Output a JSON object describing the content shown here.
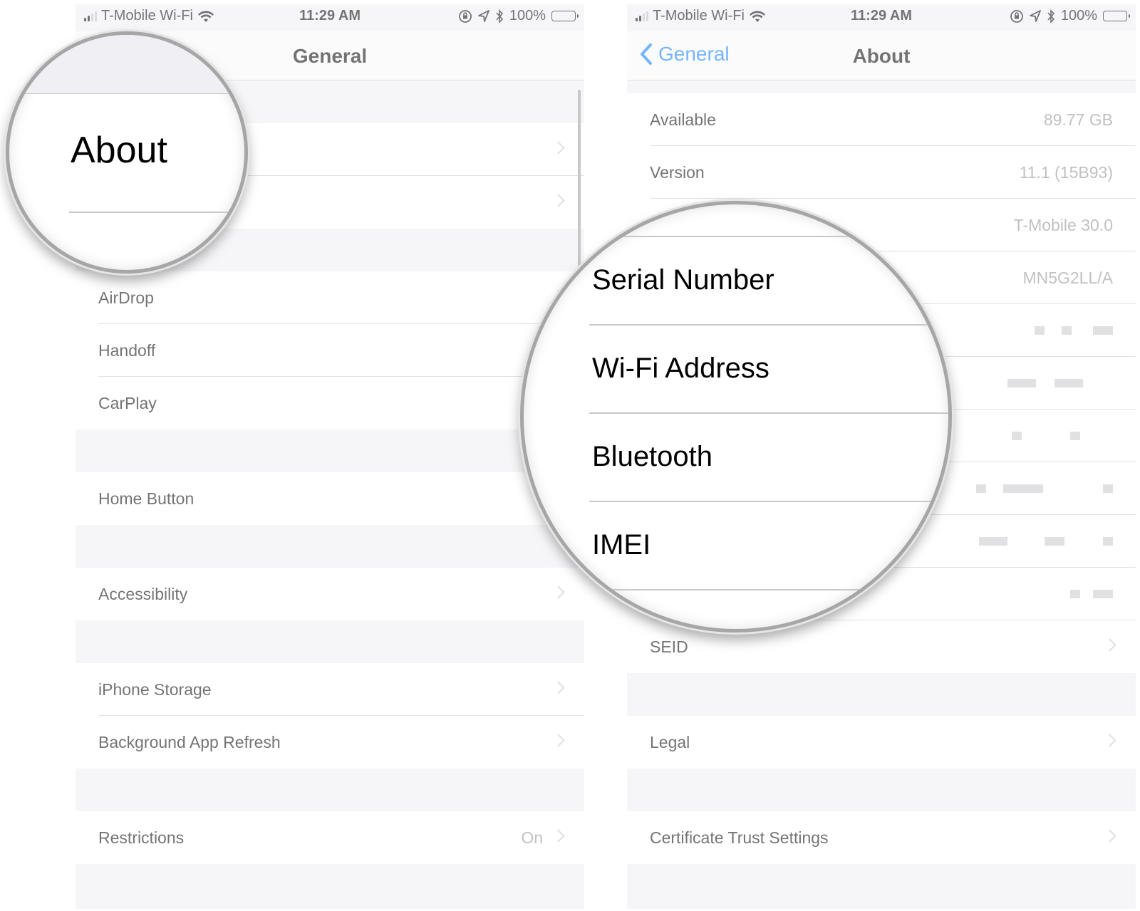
{
  "status": {
    "carrier": "T-Mobile Wi-Fi",
    "time": "11:29 AM",
    "battery": "100%",
    "battery_level": 1.0
  },
  "left": {
    "nav_title": "General",
    "zoom_label": "About",
    "groups": [
      [
        {
          "label": "AirDrop"
        },
        {
          "label": "Handoff"
        },
        {
          "label": "CarPlay"
        }
      ],
      [
        {
          "label": "Home Button"
        }
      ],
      [
        {
          "label": "Accessibility"
        }
      ],
      [
        {
          "label": "iPhone Storage"
        },
        {
          "label": "Background App Refresh"
        }
      ],
      [
        {
          "label": "Restrictions",
          "value": "On"
        }
      ]
    ]
  },
  "right": {
    "back_label": "General",
    "nav_title": "About",
    "rows": [
      {
        "label": "Available",
        "value": "89.77 GB"
      },
      {
        "label": "Version",
        "value": "11.1 (15B93)"
      },
      {
        "label": "",
        "value": "T-Mobile 30.0"
      },
      {
        "label": "",
        "value": "MN5G2LL/A"
      }
    ],
    "magnified_rows": [
      "Serial Number",
      "Wi-Fi Address",
      "Bluetooth",
      "IMEI"
    ],
    "seid_label": "SEID",
    "legal_label": "Legal",
    "cert_label": "Certificate Trust Settings"
  }
}
